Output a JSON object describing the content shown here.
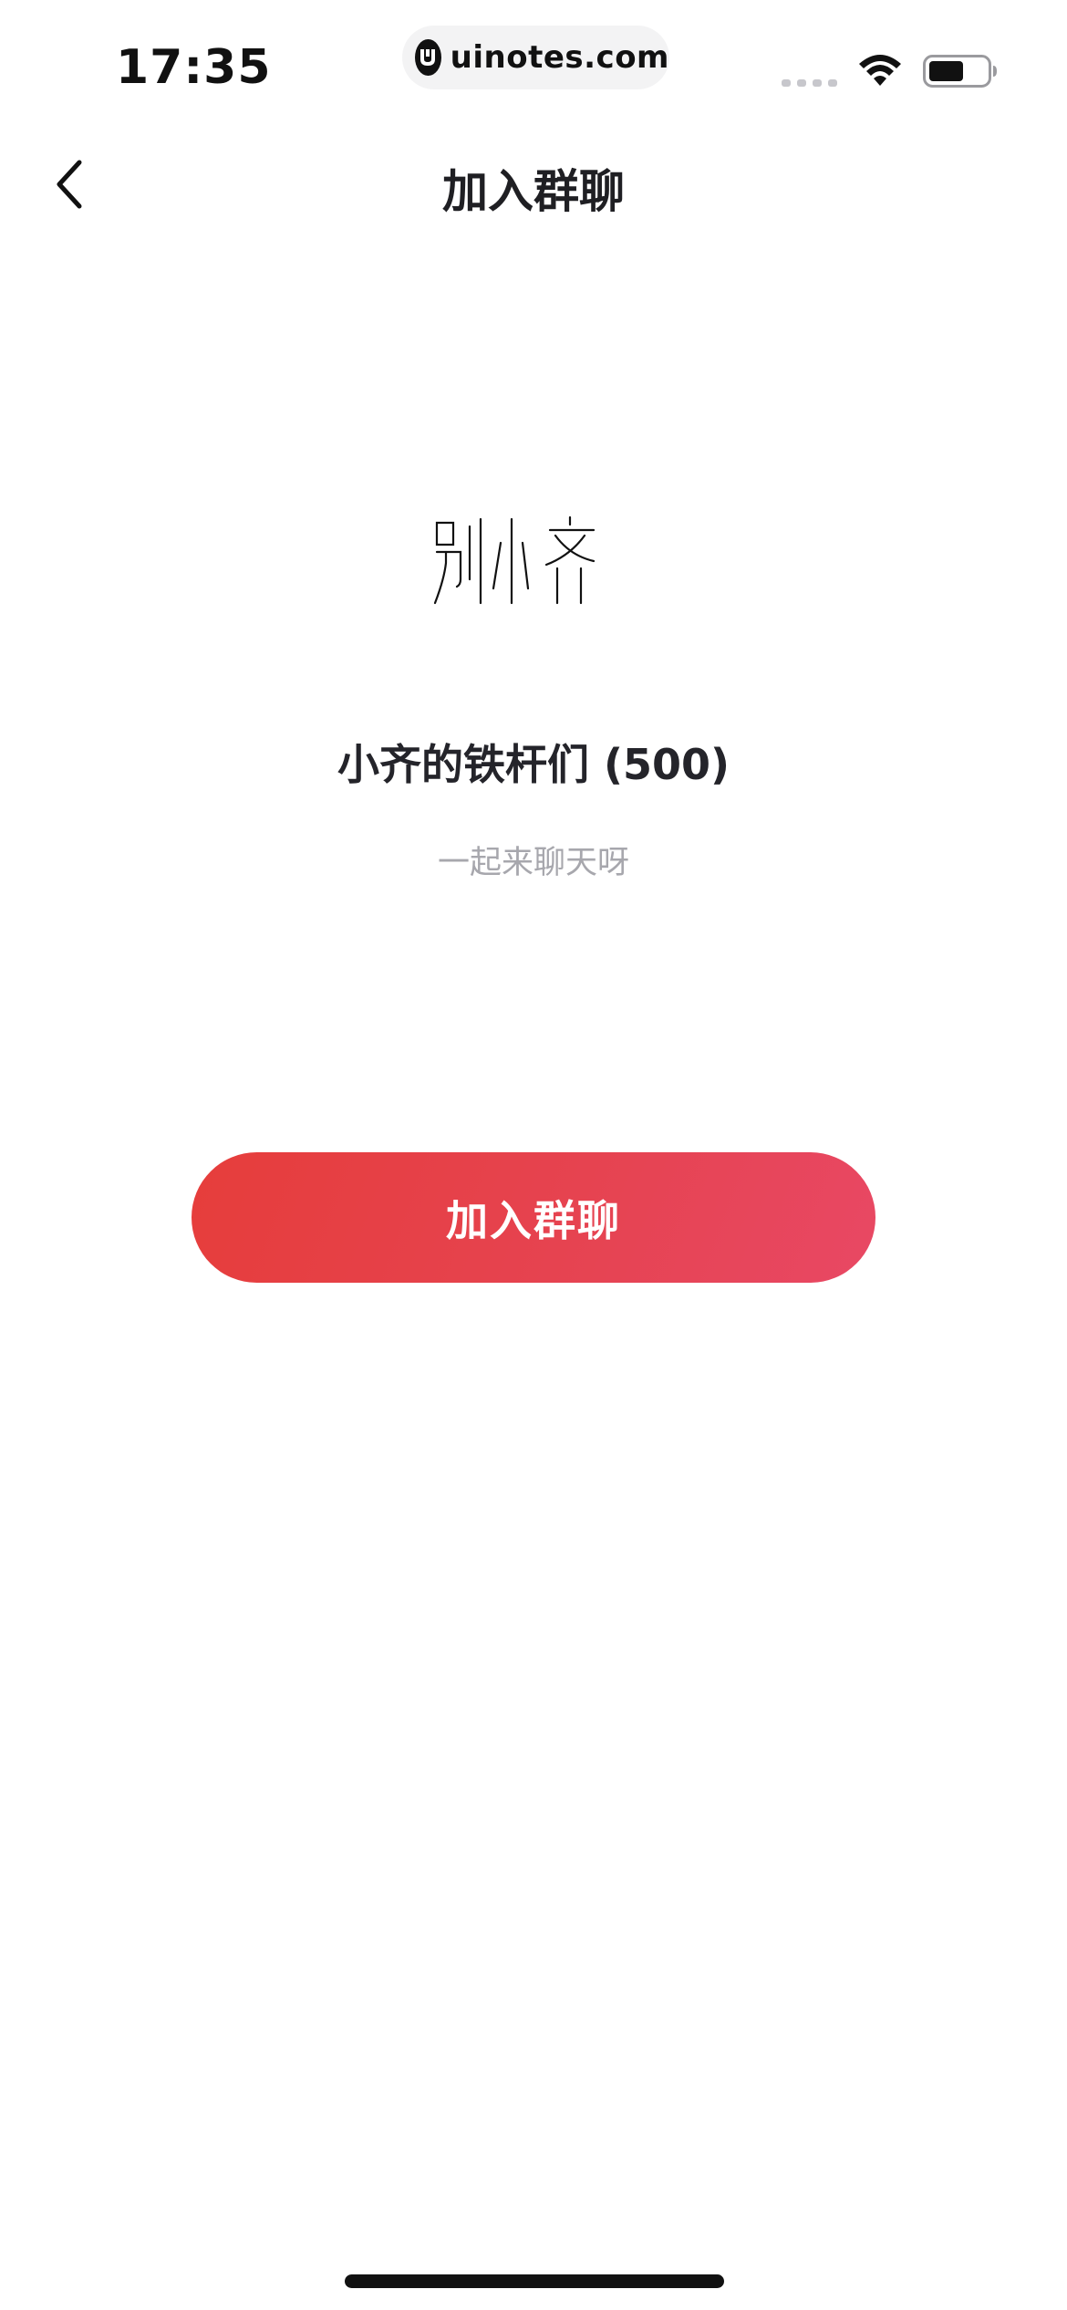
{
  "status_bar": {
    "time": "17:35",
    "url": "uinotes.com",
    "icons": [
      "uinotes-logo-icon",
      "signal-dots-icon",
      "wifi-icon",
      "battery-icon"
    ]
  },
  "nav": {
    "back_icon": "chevron-left-icon",
    "title": "加入群聊"
  },
  "group": {
    "avatar_text": "别小齐",
    "name": "小齐的铁杆们 (500)",
    "subtitle": "一起来聊天呀"
  },
  "actions": {
    "join_label": "加入群聊"
  },
  "colors": {
    "button_start": "#e63d3b",
    "button_end": "#e84864",
    "subtitle_gray": "#a7a7ad",
    "text_dark": "#1f1f23"
  }
}
